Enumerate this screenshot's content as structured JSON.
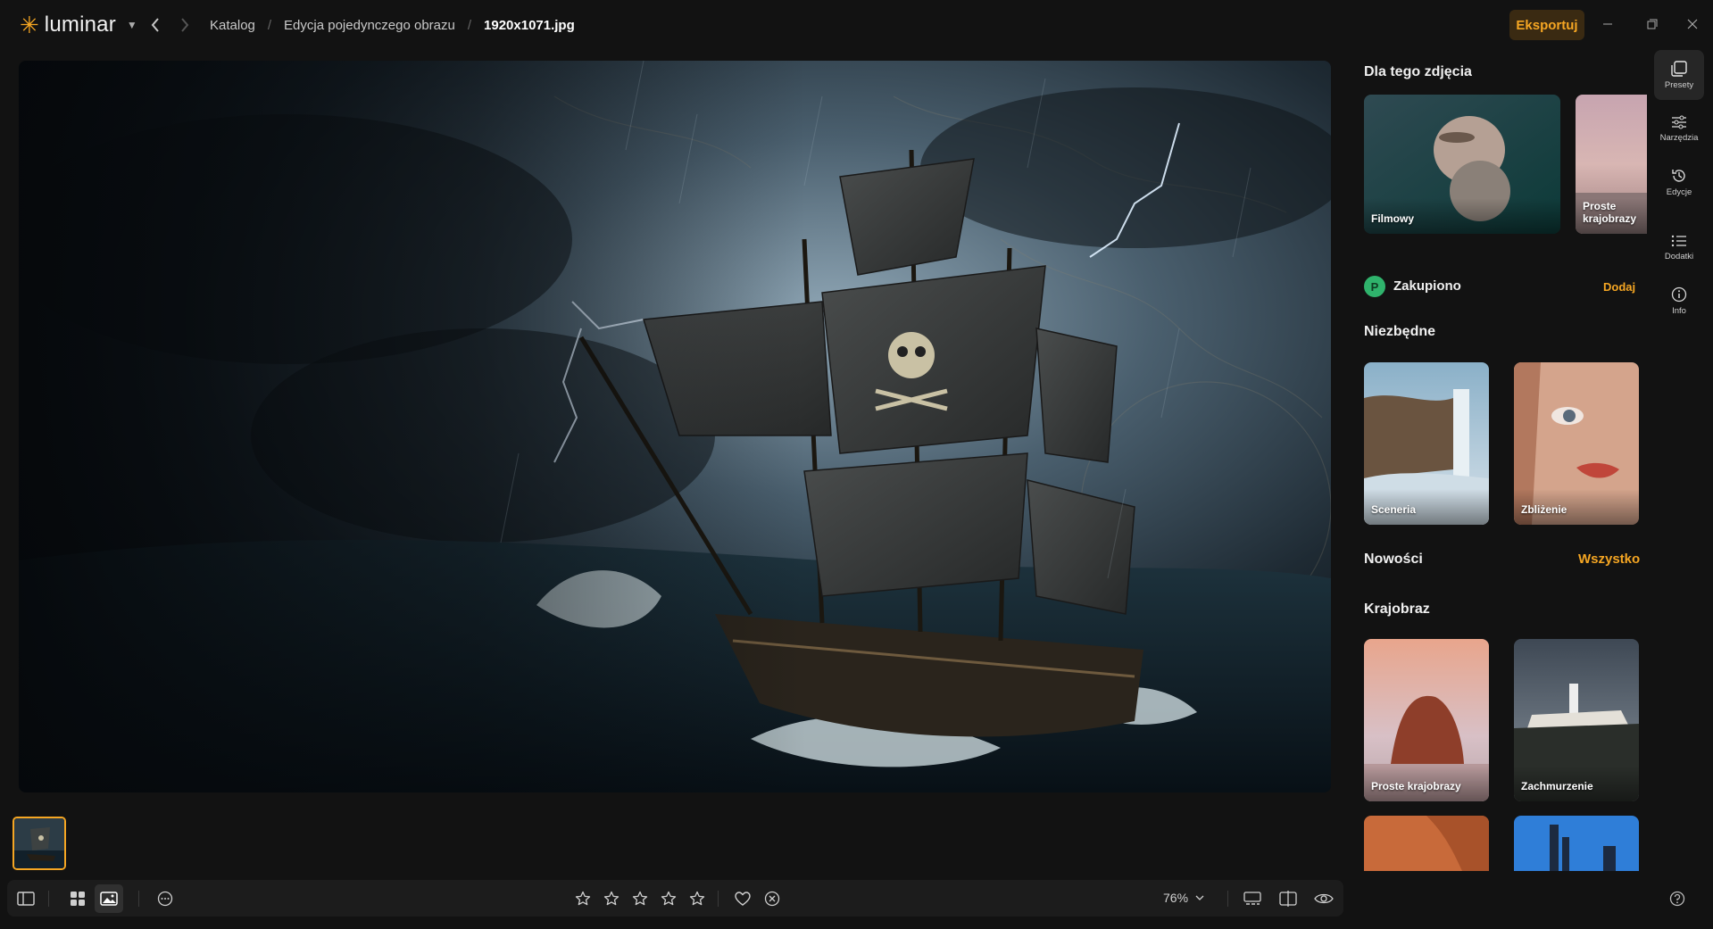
{
  "app": {
    "logo_text": "luminar",
    "logo_icon": "sun-star-icon",
    "accent_color": "#f5a623"
  },
  "breadcrumb": {
    "items": [
      "Katalog",
      "Edycja pojedynczego obrazu"
    ],
    "separator": "/",
    "current": "1920x1071.jpg"
  },
  "header": {
    "export_label": "Eksportuj"
  },
  "bottom_toolbar": {
    "zoom": "76%",
    "rating_stars": 5,
    "rating_value": 0
  },
  "panel": {
    "for_this_photo": {
      "title": "Dla tego zdjęcia",
      "cards": [
        "Filmowy",
        "Proste krajobrazy"
      ]
    },
    "purchased": {
      "label": "Zakupiono",
      "action": "Dodaj"
    },
    "essentials": {
      "title": "Niezbędne",
      "cards": [
        "Sceneria",
        "Zbliżenie"
      ]
    },
    "news": {
      "title": "Nowości",
      "action": "Wszystko"
    },
    "landscape": {
      "title": "Krajobraz",
      "cards": [
        "Proste krajobrazy",
        "Zachmurzenie"
      ]
    }
  },
  "rail": {
    "items": [
      {
        "label": "Presety",
        "icon": "presets-icon"
      },
      {
        "label": "Narzędzia",
        "icon": "sliders-icon"
      },
      {
        "label": "Edycje",
        "icon": "history-icon"
      },
      {
        "label": "Dodatki",
        "icon": "list-icon"
      },
      {
        "label": "Info",
        "icon": "info-icon"
      }
    ]
  }
}
